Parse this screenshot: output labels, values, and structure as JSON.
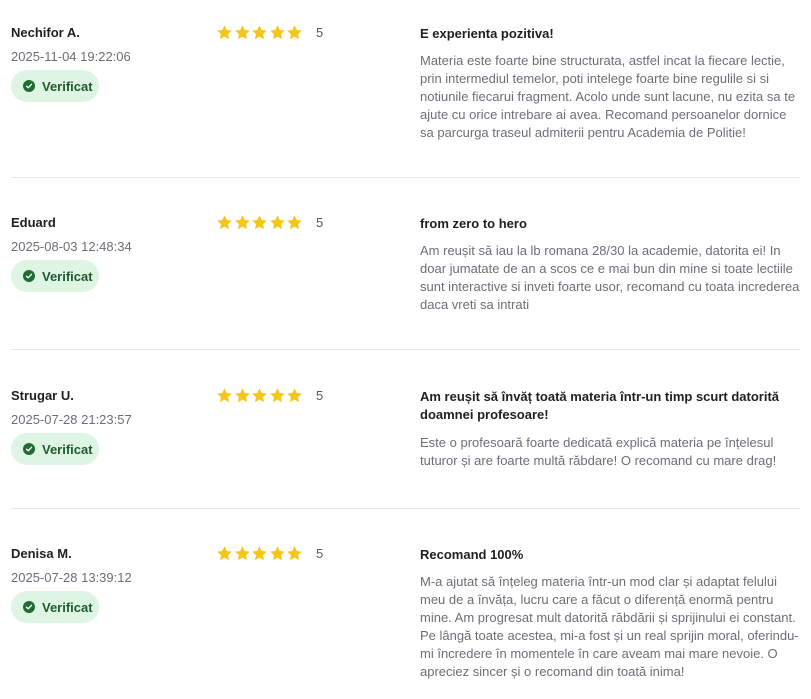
{
  "badge_label": "Verificat",
  "colors": {
    "star": "#f5c518",
    "badge_bg": "#dff5e4",
    "badge_text": "#1f5a2f",
    "check_icon": "#1f6b34"
  },
  "reviews": [
    {
      "name": "Nechifor A.",
      "date": "2025-11-04 19:22:06",
      "rating": 5,
      "rating_label": "5",
      "title": "E experienta pozitiva!",
      "body": "Materia este foarte bine structurata, astfel incat la fiecare lectie, prin intermediul temelor, poti intelege foarte bine regulile si si notiunile fiecarui fragment. Acolo unde sunt lacune, nu ezita sa te ajute cu orice intrebare ai avea. Recomand persoanelor dornice sa parcurga traseul admiterii pentru Academia de Politie!"
    },
    {
      "name": "Eduard",
      "date": "2025-08-03 12:48:34",
      "rating": 5,
      "rating_label": "5",
      "title": "from zero to hero",
      "body": "Am reușit să iau la lb romana 28/30 la academie, datorita ei! In doar jumatate de an a scos ce e mai bun din mine si toate lectiile sunt interactive si inveti foarte usor, recomand cu toata increderea daca vreti sa intrati"
    },
    {
      "name": "Strugar U.",
      "date": "2025-07-28 21:23:57",
      "rating": 5,
      "rating_label": "5",
      "title": "Am reușit să învăț toată materia într-un timp scurt datorită doamnei profesoare!",
      "body": "Este o profesoară foarte dedicată explică materia pe înțelesul tuturor și are foarte multă răbdare! O recomand cu mare drag!"
    },
    {
      "name": "Denisa M.",
      "date": "2025-07-28 13:39:12",
      "rating": 5,
      "rating_label": "5",
      "title": "Recomand 100%",
      "body": "M-a ajutat să înțeleg materia într-un mod clar și adaptat felului meu de a învăța, lucru care a făcut o diferență enormă pentru mine. Am progresat mult datorită răbdării și sprijinului ei constant. Pe lângă toate acestea, mi-a fost și un real sprijin moral, oferindu-mi încredere în momentele în care aveam mai mare nevoie. O apreciez sincer și o recomand din toată inima!"
    }
  ]
}
